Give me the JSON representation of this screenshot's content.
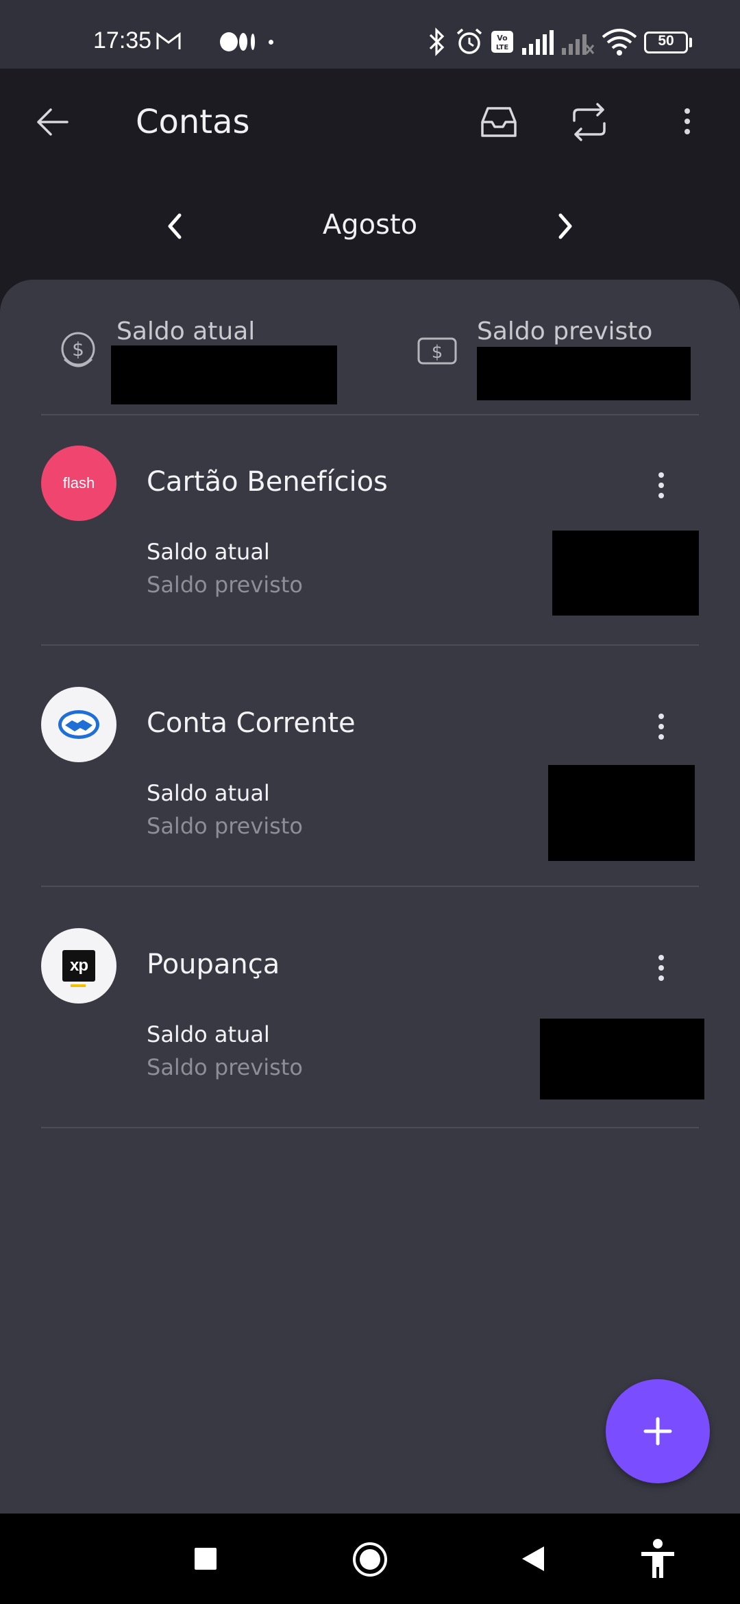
{
  "status_bar": {
    "time": "17:35",
    "battery": "50"
  },
  "header": {
    "title": "Contas",
    "icons": [
      "back-arrow-icon",
      "inbox-icon",
      "transfer-icon",
      "more-vert-icon"
    ]
  },
  "month_nav": {
    "label": "Agosto"
  },
  "summary": {
    "current_label": "Saldo atual",
    "forecast_label": "Saldo previsto"
  },
  "accounts": [
    {
      "name": "Cartão Benefícios",
      "logo": "flash",
      "line1": "Saldo atual",
      "line2": "Saldo previsto"
    },
    {
      "name": "Conta Corrente",
      "logo": "mercado-pago-handshake",
      "line1": "Saldo atual",
      "line2": "Saldo previsto"
    },
    {
      "name": "Poupança",
      "logo": "xp",
      "line1": "Saldo atual",
      "line2": "Saldo previsto"
    }
  ],
  "colors": {
    "accent": "#7a4dff",
    "card_background": "#393944",
    "app_bar": "#1b1b21",
    "flash_brand": "#f0456e"
  }
}
